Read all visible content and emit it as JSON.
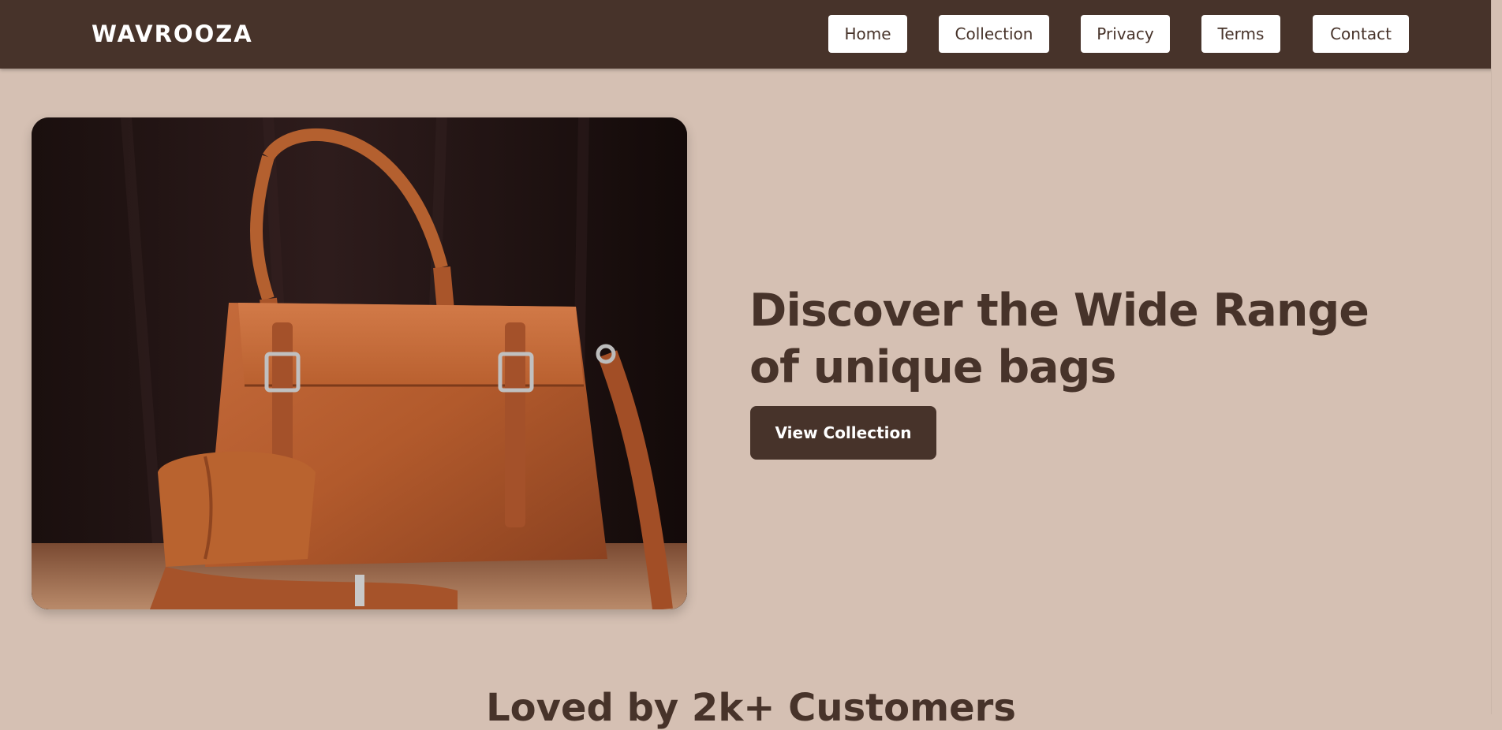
{
  "brand": {
    "name": "WAVROOZA"
  },
  "nav": {
    "items": [
      {
        "label": "Home"
      },
      {
        "label": "Collection"
      },
      {
        "label": "Privacy"
      },
      {
        "label": "Terms"
      },
      {
        "label": "Contact"
      }
    ]
  },
  "hero": {
    "title": "Discover the Wide Range of unique bags",
    "cta_label": "View Collection"
  },
  "testimonials": {
    "heading": "Loved by 2k+ Customers"
  },
  "colors": {
    "header_bg": "#47332a",
    "page_bg": "#d5c0b3",
    "accent": "#47332a",
    "button_text": "#ffffff"
  }
}
